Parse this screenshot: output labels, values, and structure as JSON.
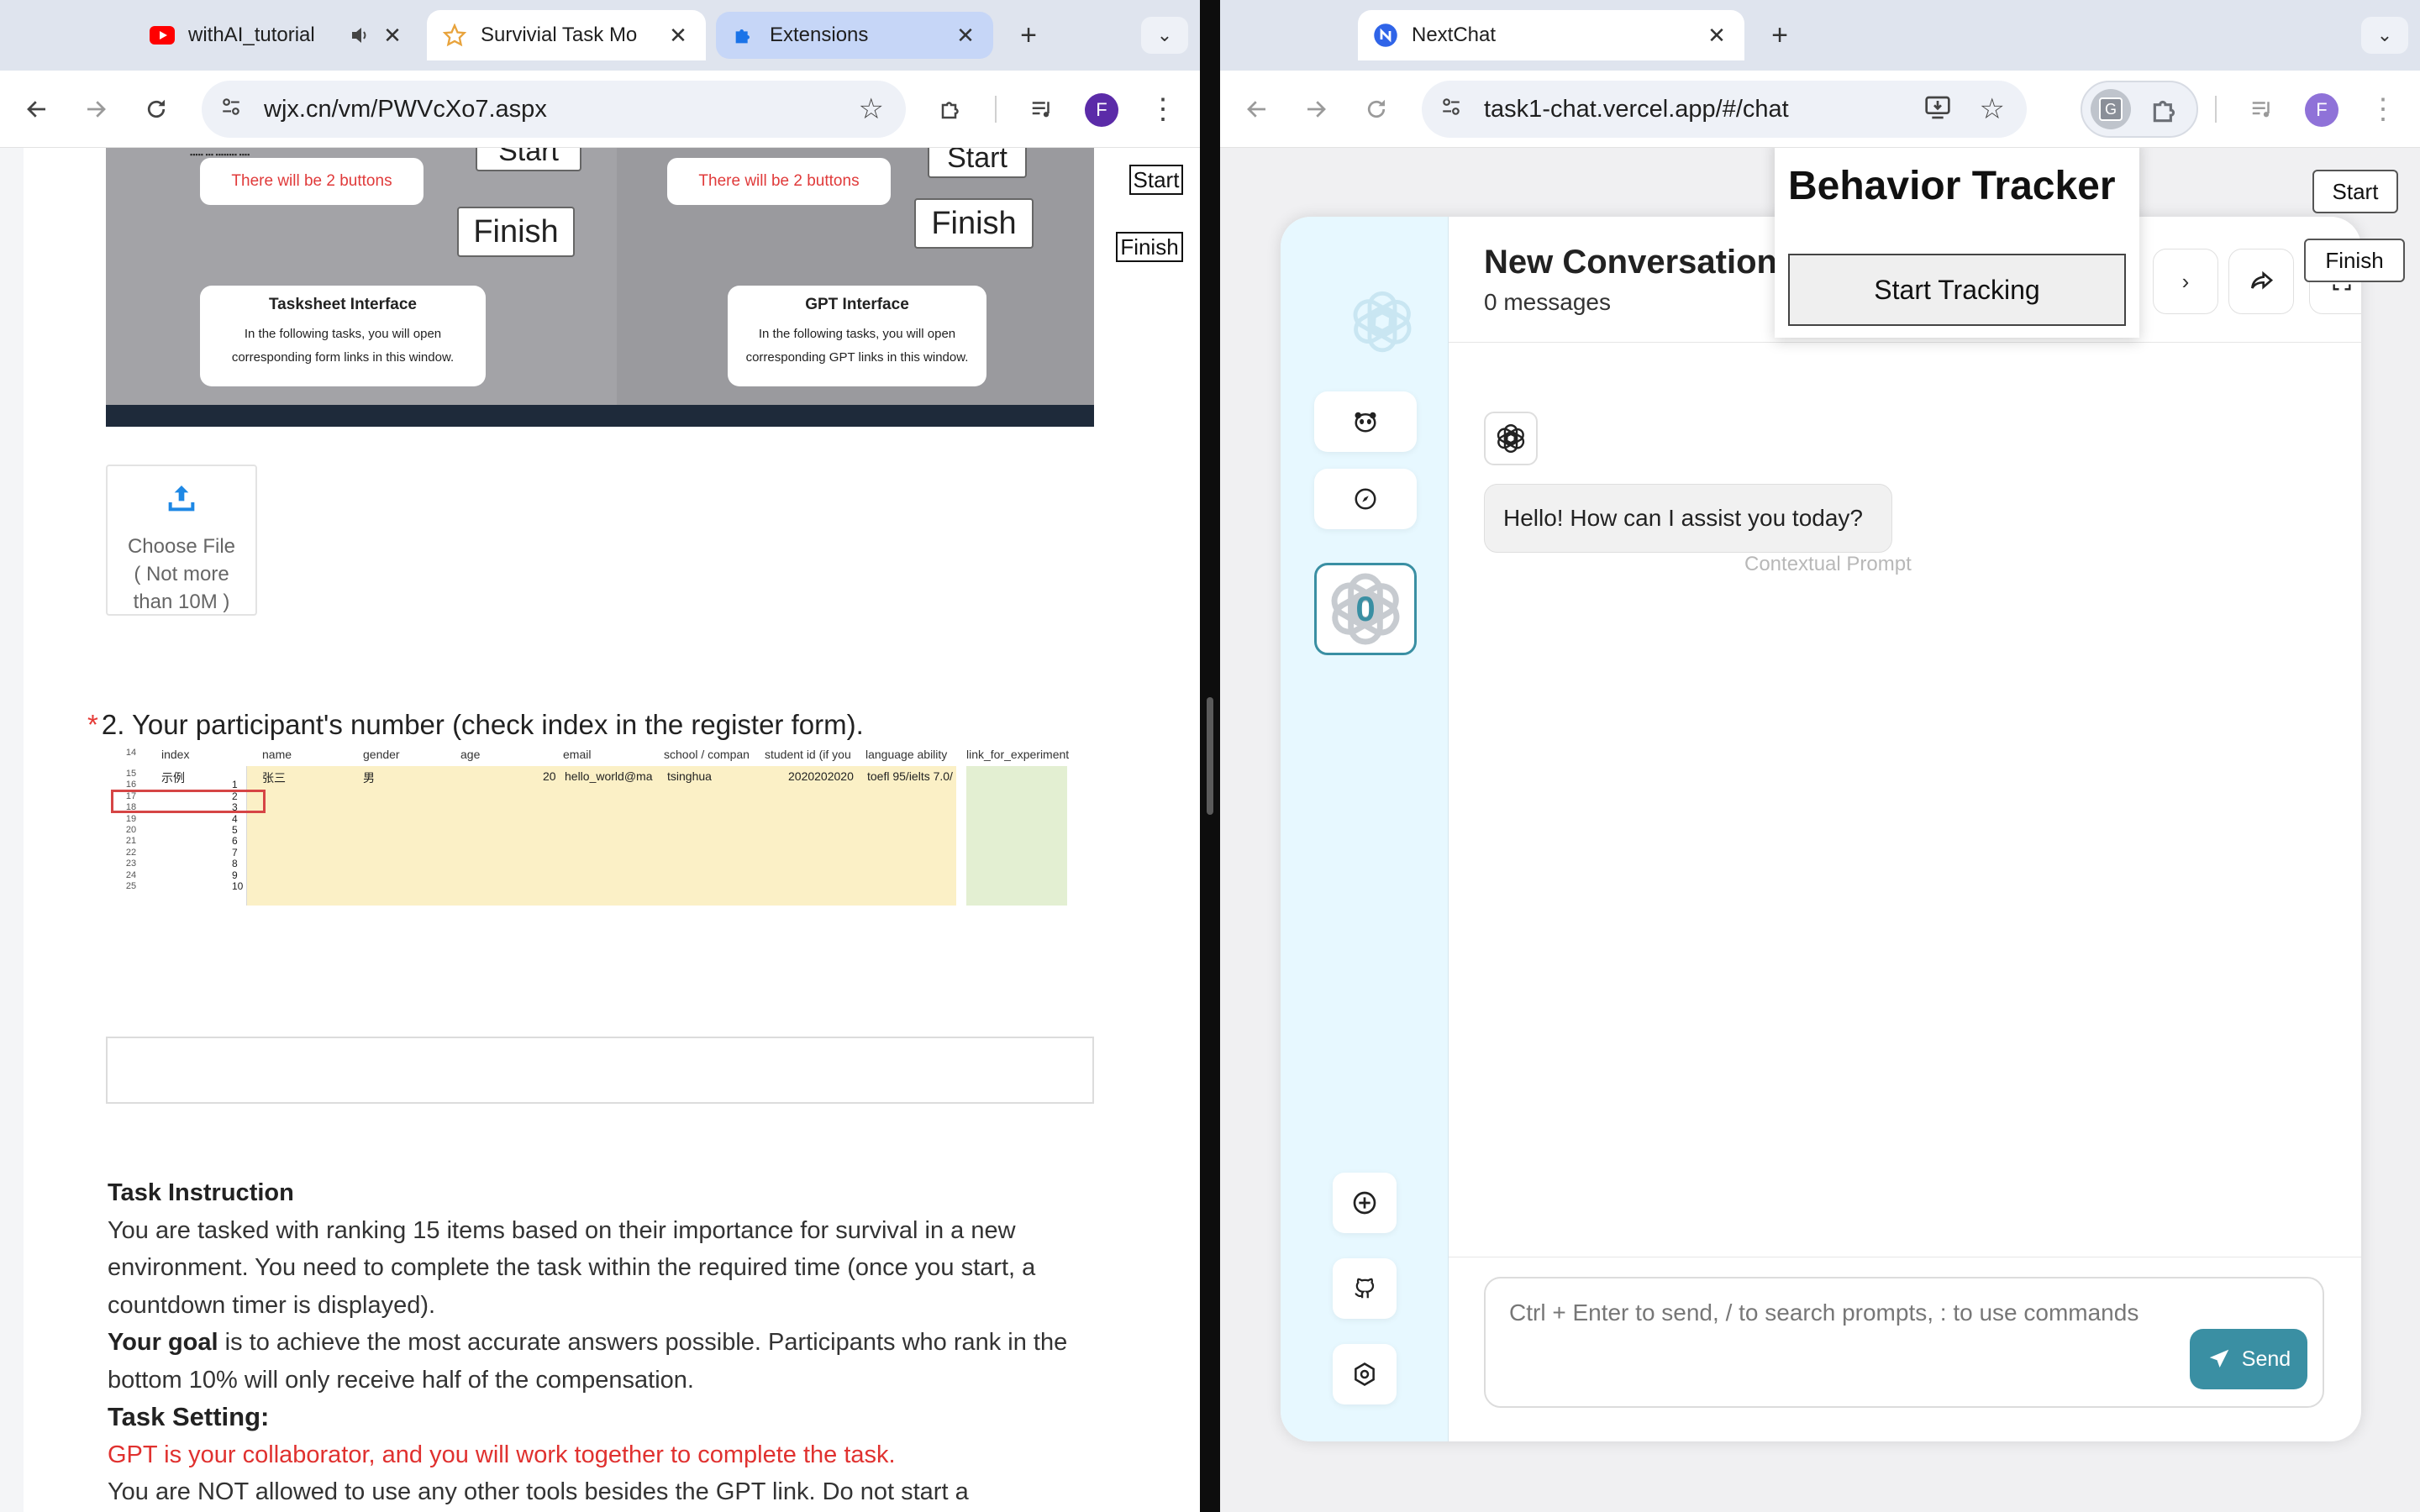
{
  "left_window": {
    "tabs": [
      {
        "title": "withAI_tutorial",
        "icon": "youtube-icon"
      },
      {
        "title": "Survivial Task Mo",
        "icon": "star-outline-icon",
        "active": true
      },
      {
        "title": "Extensions",
        "icon": "puzzle-icon"
      }
    ],
    "url": "wjx.cn/vm/PWVcXo7.aspx",
    "avatar_letter": "F"
  },
  "right_window": {
    "tabs": [
      {
        "title": "NextChat",
        "icon": "nextchat-icon",
        "active": true
      }
    ],
    "url": "task1-chat.vercel.app/#/chat",
    "avatar_letter": "F",
    "extension_badge": "G"
  },
  "survey": {
    "embedded_screenshot": {
      "left_note": "There will be 2 buttons",
      "right_note": "There will be 2 buttons",
      "finish_label": "Finish",
      "start_label": "Start",
      "tasksheet_title": "Tasksheet Interface",
      "tasksheet_body_1": "In the following tasks, you will open",
      "tasksheet_body_2": "corresponding form links in this window.",
      "gpt_title": "GPT Interface",
      "gpt_body_1": "In the following tasks, you will open",
      "gpt_body_2": "corresponding GPT links in this window."
    },
    "side_start": "Start",
    "side_finish": "Finish",
    "upload": {
      "line1": "Choose File",
      "line2": "( Not more",
      "line3": "than 10M )"
    },
    "q2_required_mark": "*",
    "q2_label": "2. Your participant's number (check index in the register form).",
    "sheet": {
      "columns": [
        "index",
        "name",
        "gender",
        "age",
        "email",
        "school / compan",
        "student id (if you",
        "language ability",
        "link_for_experiment"
      ],
      "row_numbers": [
        "14",
        "15",
        "16",
        "17",
        "18",
        "19",
        "20",
        "21",
        "22",
        "23",
        "24",
        "25"
      ],
      "example_row": {
        "index": "示例",
        "name": "张三",
        "gender": "男",
        "age": "20",
        "email": "hello_world@ma",
        "school": "tsinghua",
        "student_id": "2020202020",
        "language": "toefl 95/ielts 7.0/"
      },
      "index_values": [
        "1",
        "2",
        "3",
        "4",
        "5",
        "6",
        "7",
        "8",
        "9",
        "10"
      ]
    },
    "instruction": {
      "heading": "Task Instruction",
      "p1": "You are tasked with ranking 15 items based on their importance for survival in a new environment. You need to complete the task within the required time (once you start, a countdown timer is displayed).",
      "goal_label": "Your goal",
      "p2": " is to achieve the most accurate answers possible. Participants who rank in the bottom 10% will only receive half of the compensation.",
      "setting_heading": "Task Setting:",
      "red_line": "GPT is your collaborator, and you will work together to complete the task.",
      "p3": "You are NOT allowed to use any other tools besides the GPT link.  Do not start a"
    }
  },
  "chat": {
    "title": "New Conversation",
    "subtitle": "0 messages",
    "greeting": "Hello! How can I assist you today?",
    "context_label": "Contextual Prompt",
    "mask_count": "0",
    "composer_placeholder": "Ctrl + Enter to send, / to search prompts, : to use commands",
    "send_label": "Send"
  },
  "tracker": {
    "title": "Behavior Tracker",
    "button": "Start Tracking",
    "side_start": "Start",
    "side_finish": "Finish"
  },
  "colors": {
    "tab_strip": "#dfe4ee",
    "accent_teal": "#3a8fa3",
    "required_red": "#e53935",
    "sidebar_bg": "#e7f8ff"
  }
}
